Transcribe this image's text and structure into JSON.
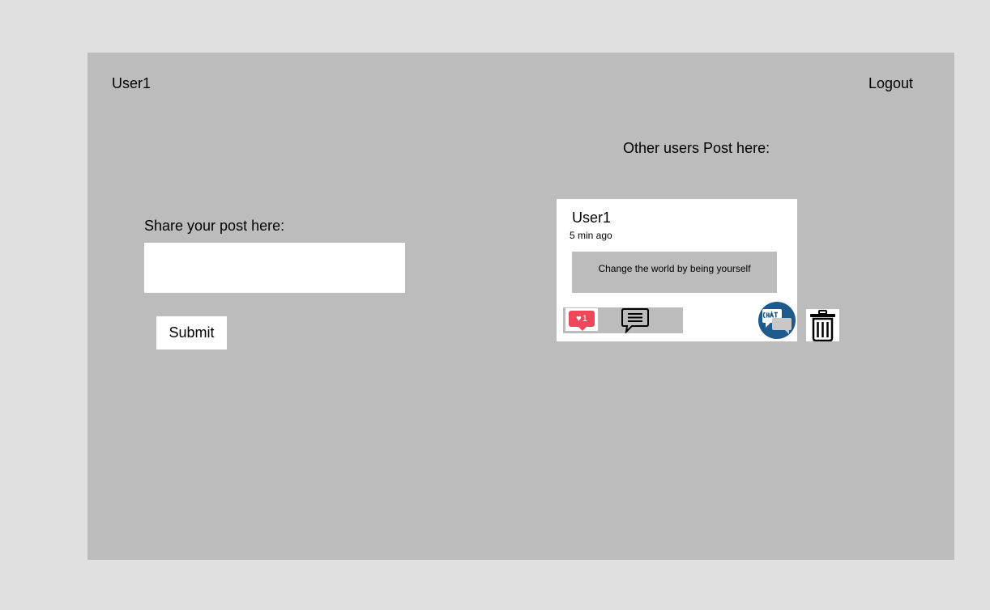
{
  "header": {
    "username": "User1",
    "logout_label": "Logout"
  },
  "composer": {
    "label": "Share your post here:",
    "input_value": "",
    "submit_label": "Submit"
  },
  "feed": {
    "heading": "Other users Post here:",
    "posts": [
      {
        "author": "User1",
        "time": "5 min ago",
        "content": "Change the world by being yourself",
        "like_count": "1",
        "icons": [
          "heart-icon",
          "comment-icon",
          "chat-icon",
          "trash-icon"
        ]
      }
    ]
  },
  "colors": {
    "page_bg": "#e0e0e0",
    "frame_bg": "#bcbcbc",
    "like_badge": "#f0465a",
    "chat_icon": "#1e5a8c"
  }
}
